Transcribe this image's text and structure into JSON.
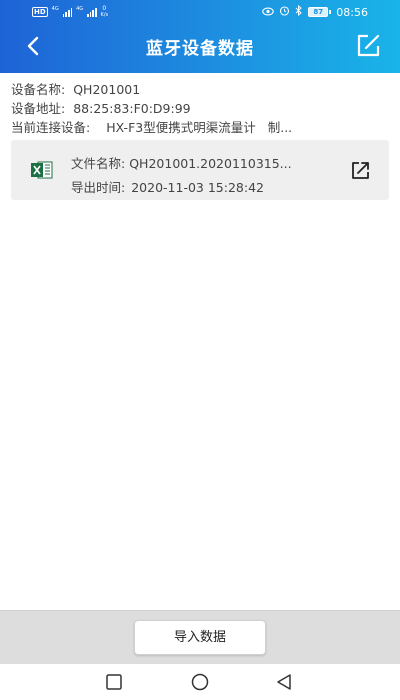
{
  "status_bar": {
    "left": {
      "hd_label": "HD",
      "sim1": "4G",
      "sim2": "4G",
      "net_speed_value": "0",
      "net_speed_unit": "K/s"
    },
    "right": {
      "icons": [
        "eye-icon",
        "alarm-icon",
        "bluetooth-icon"
      ],
      "battery_level": "87",
      "time": "08:56"
    }
  },
  "app_bar": {
    "title": "蓝牙设备数据",
    "back_icon": "chevron-left-icon",
    "edit_icon": "edit-icon"
  },
  "device_info": {
    "name_label": "设备名称:",
    "name_value": "QH201001",
    "address_label": "设备地址:",
    "address_value": "88:25:83:F0:D9:99",
    "connected_label": "当前连接设备:",
    "connected_value": "HX-F3型便携式明渠流量计",
    "connected_suffix": "制..."
  },
  "files": [
    {
      "icon": "excel-icon",
      "name_label": "文件名称:",
      "name_value": "QH201001.2020110315...",
      "time_label": "导出时间:",
      "time_value": "2020-11-03 15:28:42",
      "action_icon": "share-icon"
    }
  ],
  "bottom": {
    "import_label": "导入数据"
  },
  "nav": {
    "items": [
      "recents-icon",
      "home-icon",
      "back-icon"
    ]
  },
  "colors": {
    "header_start": "#1e63d6",
    "header_end": "#19b4e8",
    "card_bg": "#efefef",
    "bottom_bar_bg": "#dddddd",
    "excel_green": "#1d7044"
  }
}
